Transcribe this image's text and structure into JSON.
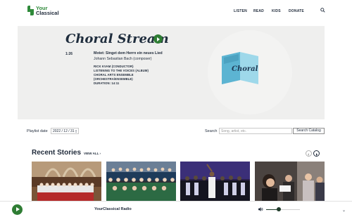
{
  "header": {
    "logo_line1": "Your",
    "logo_line2": "Classical",
    "nav": [
      "LISTEN",
      "READ",
      "KIDS",
      "DONATE"
    ]
  },
  "hero": {
    "title": "Choral Stream",
    "time": "1:26",
    "track_title": "Motet: Singet dem Herrn ein neues Lied",
    "composer": "Johann Sebastian Bach (composer)",
    "credits": [
      "RICK KVAM (CONDUCTOR)",
      "LISTENING TO THE VOICES (ALBUM)",
      "CHORAL ARTS ENSEMBLE",
      "(ORCHESTRA/ENSEMBLE)",
      "DURATION: 14:11"
    ],
    "album_label": "Choral"
  },
  "playlist": {
    "date_label": "Playlist date",
    "date_value": "2022 / 12 / 31",
    "search_label": "Search",
    "search_placeholder": "Song, artist, etc.",
    "search_button": "Search Catalog"
  },
  "stories": {
    "title": "Recent Stories",
    "view_all": "VIEW ALL ›",
    "items": [
      "choir-in-cathedral",
      "choir-on-stage",
      "gospel-choir-concert",
      "singers-rehearsing"
    ]
  },
  "player": {
    "station": "YourClassical Radio",
    "volume": 0.38
  },
  "colors": {
    "brand_green": "#2f7d34",
    "navy": "#1f2a3a",
    "hero_bg": "#efefee"
  }
}
